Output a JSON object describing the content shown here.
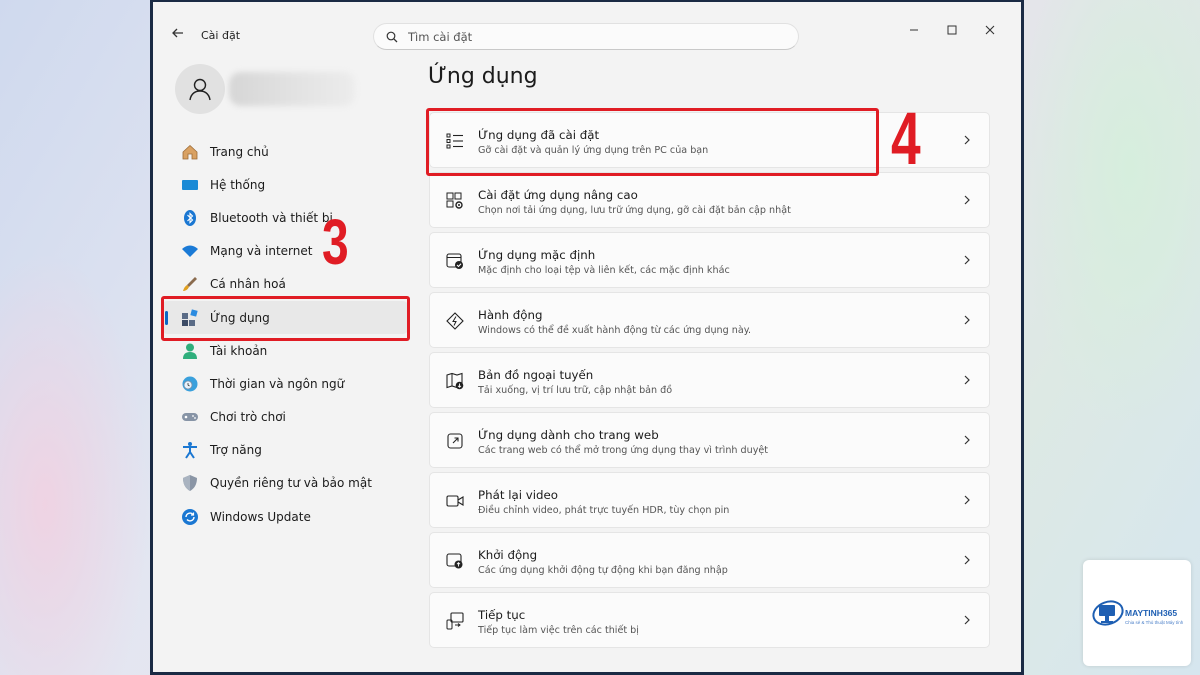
{
  "window": {
    "app_title": "Cài đặt",
    "search_placeholder": "Tìm cài đặt"
  },
  "nav": {
    "items": [
      {
        "label": "Trang chủ",
        "icon": "home-icon"
      },
      {
        "label": "Hệ thống",
        "icon": "display-icon"
      },
      {
        "label": "Bluetooth và thiết bị",
        "icon": "bluetooth-icon"
      },
      {
        "label": "Mạng và internet",
        "icon": "wifi-icon"
      },
      {
        "label": "Cá nhân hoá",
        "icon": "brush-icon"
      },
      {
        "label": "Ứng dụng",
        "icon": "apps-icon",
        "active": true
      },
      {
        "label": "Tài khoản",
        "icon": "account-icon"
      },
      {
        "label": "Thời gian và ngôn ngữ",
        "icon": "globe-clock-icon"
      },
      {
        "label": "Chơi trò chơi",
        "icon": "gamepad-icon"
      },
      {
        "label": "Trợ năng",
        "icon": "accessibility-icon"
      },
      {
        "label": "Quyền riêng tư và bảo mật",
        "icon": "shield-icon"
      },
      {
        "label": "Windows Update",
        "icon": "update-icon"
      }
    ]
  },
  "main": {
    "title": "Ứng dụng",
    "cards": [
      {
        "title": "Ứng dụng đã cài đặt",
        "desc": "Gỡ cài đặt và quản lý ứng dụng trên PC của bạn",
        "icon": "list-icon"
      },
      {
        "title": "Cài đặt ứng dụng nâng cao",
        "desc": "Chọn nơi tải ứng dụng, lưu trữ ứng dụng, gỡ cài đặt bản cập nhật",
        "icon": "apps-gear-icon"
      },
      {
        "title": "Ứng dụng mặc định",
        "desc": "Mặc định cho loại tệp và liên kết, các mặc định khác",
        "icon": "default-apps-icon"
      },
      {
        "title": "Hành động",
        "desc": "Windows có thể đề xuất hành động từ các ứng dụng này.",
        "icon": "action-icon"
      },
      {
        "title": "Bản đồ ngoại tuyến",
        "desc": "Tải xuống, vị trí lưu trữ, cập nhật bản đồ",
        "icon": "map-icon"
      },
      {
        "title": "Ứng dụng dành cho trang web",
        "desc": "Các trang web có thể mở trong ứng dụng thay vì trình duyệt",
        "icon": "open-external-icon"
      },
      {
        "title": "Phát lại video",
        "desc": "Điều chỉnh video, phát trực tuyến HDR, tùy chọn pin",
        "icon": "video-icon"
      },
      {
        "title": "Khởi động",
        "desc": "Các ứng dụng khởi động tự động khi bạn đăng nhập",
        "icon": "startup-icon"
      },
      {
        "title": "Tiếp tục",
        "desc": "Tiếp tục làm việc trên các thiết bị",
        "icon": "resume-icon"
      }
    ]
  },
  "annotations": {
    "step3": "3",
    "step4": "4",
    "color": "#e01c24"
  },
  "watermark": {
    "brand": "MAYTINH365",
    "tagline": "Chia sẻ & Thủ thuật Máy tính"
  }
}
